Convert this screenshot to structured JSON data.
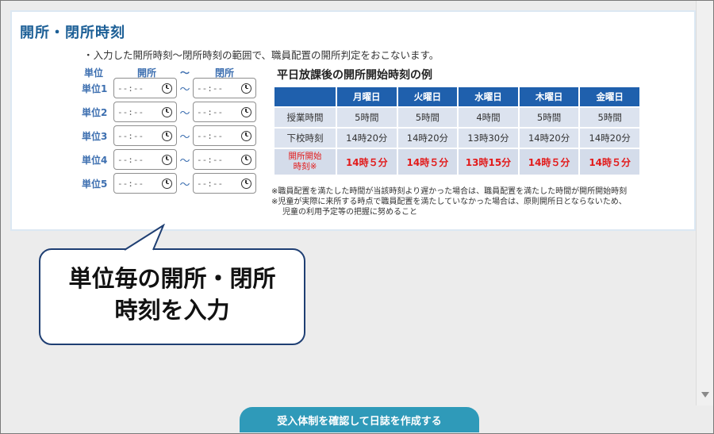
{
  "section": {
    "title": "開所・閉所時刻",
    "description": "・入力した開所時刻～閉所時刻の範囲で、職員配置の開所判定をおこないます。"
  },
  "unit_headers": {
    "unit": "単位",
    "open": "開所",
    "tilde": "～",
    "close": "閉所"
  },
  "units": [
    {
      "label": "単位1",
      "open_value": "--:--",
      "close_value": "--:--"
    },
    {
      "label": "単位2",
      "open_value": "--:--",
      "close_value": "--:--"
    },
    {
      "label": "単位3",
      "open_value": "--:--",
      "close_value": "--:--"
    },
    {
      "label": "単位4",
      "open_value": "--:--",
      "close_value": "--:--"
    },
    {
      "label": "単位5",
      "open_value": "--:--",
      "close_value": "--:--"
    }
  ],
  "example_table": {
    "title": "平日放課後の開所開始時刻の例",
    "columns": [
      "月曜日",
      "火曜日",
      "水曜日",
      "木曜日",
      "金曜日"
    ],
    "rows": [
      {
        "label": "授業時間",
        "values": [
          "5時間",
          "5時間",
          "4時間",
          "5時間",
          "5時間"
        ]
      },
      {
        "label": "下校時刻",
        "values": [
          "14時20分",
          "14時20分",
          "13時30分",
          "14時20分",
          "14時20分"
        ]
      }
    ],
    "start_row": {
      "label_line1": "開所開始",
      "label_line2": "時刻※",
      "values": [
        "14時５分",
        "14時５分",
        "13時15分",
        "14時５分",
        "14時５分"
      ]
    },
    "colors": {
      "header_bg": "#1f60ad",
      "cell_bg": "#dce3ef",
      "highlight": "#e21b1b"
    }
  },
  "notes": [
    "※職員配置を満たした時間が当該時刻より遅かった場合は、職員配置を満たした時間が開所開始時刻",
    "※児童が実際に来所する時点で職員配置を満たしていなかった場合は、原則開所日とならないため、",
    "児童の利用予定等の把握に努めること"
  ],
  "callout": {
    "line1": "単位毎の開所・閉所",
    "line2": "時刻を入力"
  },
  "submit_button": {
    "label": "受入体制を確認して日誌を作成する",
    "color": "#2f9ab9"
  },
  "icons": {
    "time": "clock-icon",
    "scroll": "scroll-down-arrow-icon"
  }
}
